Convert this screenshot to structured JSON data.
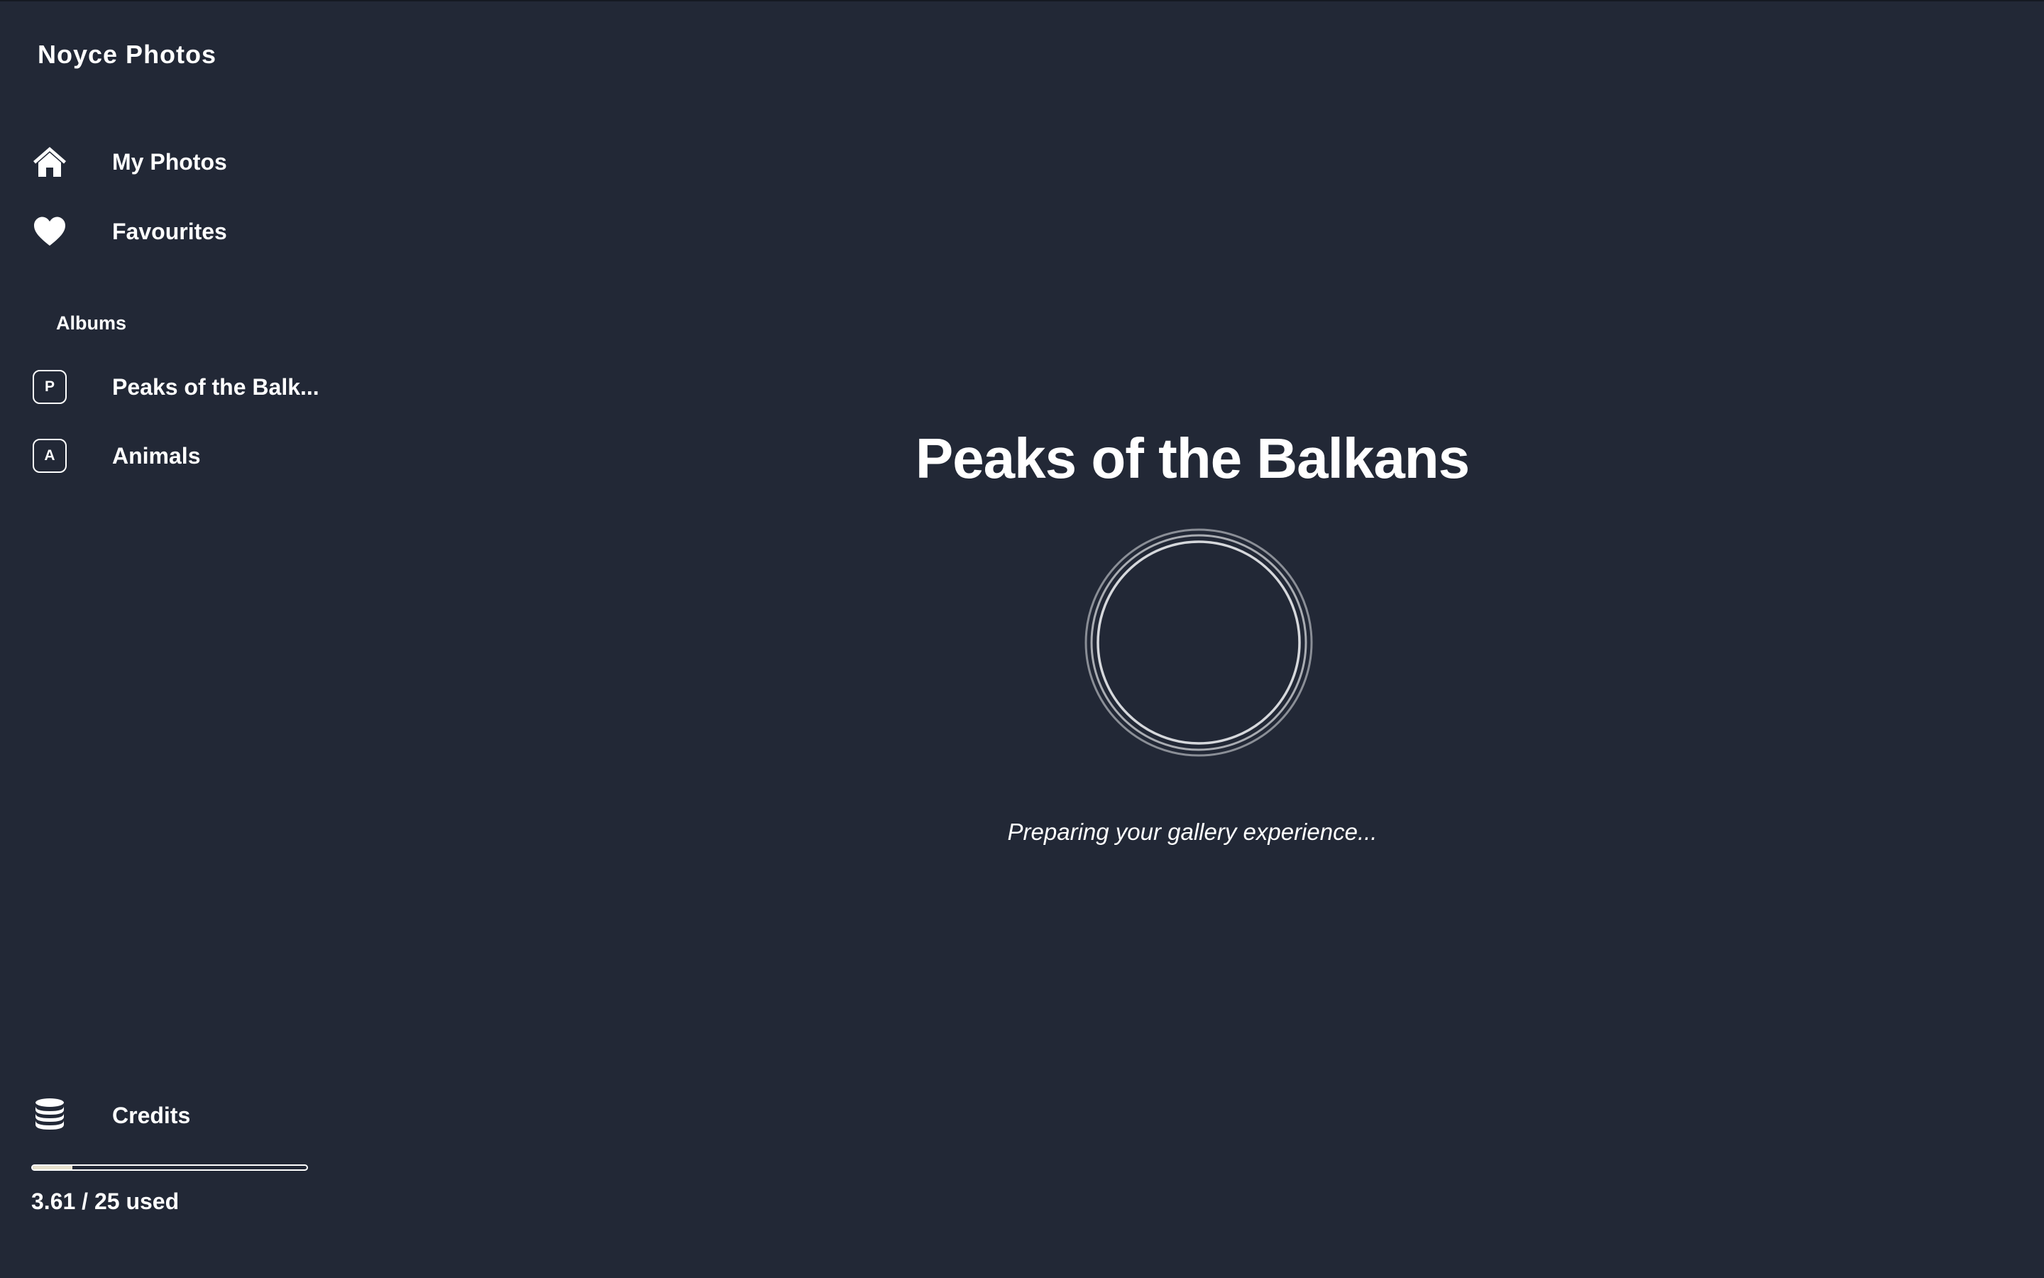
{
  "app": {
    "title": "Noyce Photos"
  },
  "sidebar": {
    "nav": [
      {
        "label": "My Photos",
        "icon": "home-icon"
      },
      {
        "label": "Favourites",
        "icon": "heart-icon"
      }
    ],
    "albums_header": "Albums",
    "albums": [
      {
        "initial": "P",
        "label": "Peaks of the Balk..."
      },
      {
        "initial": "A",
        "label": "Animals"
      }
    ],
    "credits": {
      "label": "Credits",
      "icon": "coins-stack-icon",
      "used": 3.61,
      "total": 25,
      "usage_text": "3.61 / 25 used"
    }
  },
  "main": {
    "title": "Peaks of the Balkans",
    "loading_text": "Preparing your gallery experience..."
  },
  "colors": {
    "background": "#222836",
    "text": "#ffffff",
    "progress_fill": "#e8e2cf"
  }
}
